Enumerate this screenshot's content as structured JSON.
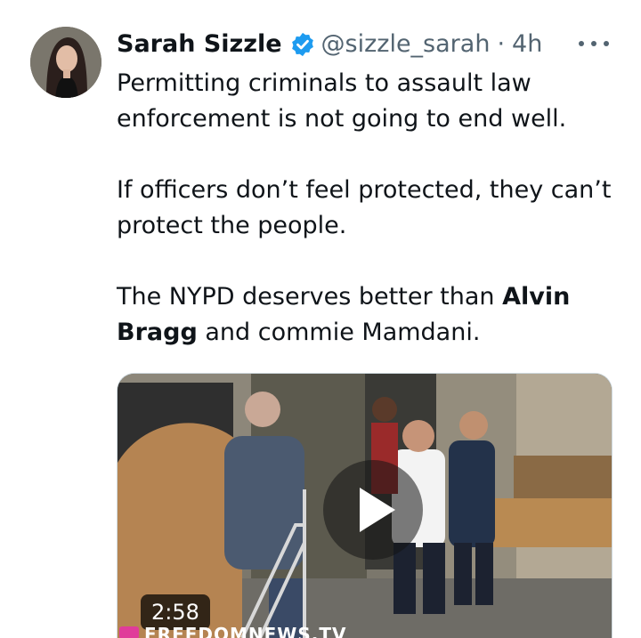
{
  "author": {
    "name": "Sarah Sizzle",
    "handle": "@sizzle_sarah",
    "separator": "·",
    "time": "4h"
  },
  "tweet": {
    "paragraph1": "Permitting criminals to assault law enforcement is not going to end well.",
    "paragraph2": "If officers don’t feel protected, they can’t protect the people.",
    "paragraph3_before": "The NYPD deserves better than ",
    "paragraph3_bold": "Alvin Bragg",
    "paragraph3_after": " and commie Mamdani."
  },
  "media": {
    "duration": "2:58",
    "watermark": "FREEDOMNEWS.TV"
  },
  "icons": {
    "verified": "verified-badge-icon",
    "more": "more-options-icon",
    "play": "play-icon"
  },
  "colors": {
    "verified": "#1d9bf0",
    "muted": "#536471",
    "text": "#0f1419"
  }
}
